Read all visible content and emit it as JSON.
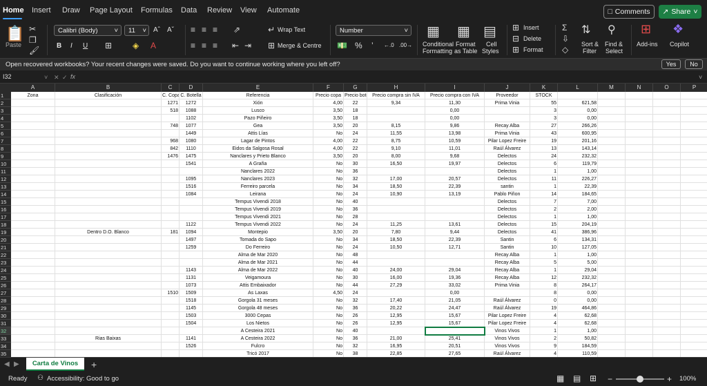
{
  "tabs": [
    "Home",
    "Insert",
    "Draw",
    "Page Layout",
    "Formulas",
    "Data",
    "Review",
    "View",
    "Automate"
  ],
  "header": {
    "comments": "Comments",
    "share": "Share"
  },
  "ribbon": {
    "paste": "Paste",
    "font_name": "Calibri (Body)",
    "font_size": "11",
    "wrap_text": "Wrap Text",
    "merge_center": "Merge & Centre",
    "number_format": "Number",
    "conditional": "Conditional",
    "formatting": "Formatting",
    "format_as": "Format",
    "as_table": "as Table",
    "cell": "Cell",
    "styles": "Styles",
    "insert": "Insert",
    "delete": "Delete",
    "format": "Format",
    "sort": "Sort &",
    "filter": "Filter",
    "find": "Find &",
    "select": "Select",
    "addins": "Add-ins",
    "copilot": "Copilot",
    "bold": "B",
    "italic": "I",
    "underline": "U"
  },
  "notice": {
    "text": "Open recovered workbooks?  Your recent changes were saved. Do you want to continue working where you left off?",
    "yes": "Yes",
    "no": "No"
  },
  "formula_bar": {
    "name_box": "I32",
    "fx": "fx"
  },
  "columns": [
    "A",
    "B",
    "C",
    "D",
    "E",
    "F",
    "G",
    "H",
    "I",
    "J",
    "K",
    "L",
    "M",
    "N",
    "O",
    "P",
    "Q"
  ],
  "headers": [
    "Zona",
    "Clasificación",
    "C. Copa",
    "C. Botella",
    "Referencia",
    "Precio copa",
    "Precio bote",
    "Precio compra sin IVA",
    "Precio compra con IVA",
    "Proveedor",
    "STOCK",
    "",
    "",
    "",
    "",
    "",
    ""
  ],
  "rows": [
    [
      "",
      "",
      "1271",
      "1272",
      "Xión",
      "4,00",
      "22",
      "9,34",
      "11,30",
      "Prima Vinia",
      "55",
      "621,58"
    ],
    [
      "",
      "",
      "518",
      "1088",
      "Lusco",
      "3,50",
      "18",
      "",
      "0,00",
      "",
      "3",
      "0,00"
    ],
    [
      "",
      "",
      "",
      "1102",
      "Pazo Piñeiro",
      "3,50",
      "18",
      "",
      "0,00",
      "",
      "3",
      "0,00"
    ],
    [
      "",
      "",
      "748",
      "1077",
      "Gea",
      "3,50",
      "20",
      "8,15",
      "9,86",
      "Recay Alba",
      "27",
      "266,26"
    ],
    [
      "",
      "",
      "",
      "1449",
      "Attis Lías",
      "No",
      "24",
      "11,55",
      "13,98",
      "Prima Vinia",
      "43",
      "600,95"
    ],
    [
      "",
      "",
      "968",
      "1080",
      "Lagar de Pintos",
      "4,00",
      "22",
      "8,75",
      "10,59",
      "Pilar Lopez Freire",
      "19",
      "201,16"
    ],
    [
      "",
      "",
      "842",
      "1110",
      "Eidos da Salgosa Rosal",
      "4,00",
      "22",
      "9,10",
      "11,01",
      "Raúl Álvarez",
      "13",
      "143,14"
    ],
    [
      "",
      "",
      "1476",
      "1475",
      "Nanclares y Prieto Blanco",
      "3,50",
      "20",
      "8,00",
      "9,68",
      "Delectos",
      "24",
      "232,32"
    ],
    [
      "",
      "",
      "",
      "1541",
      "A Graña",
      "No",
      "30",
      "16,50",
      "19,97",
      "Delectos",
      "6",
      "119,79"
    ],
    [
      "",
      "",
      "",
      "",
      "Nanclares 2022",
      "No",
      "36",
      "",
      "",
      "Delectos",
      "1",
      "1,00"
    ],
    [
      "",
      "",
      "",
      "1095",
      "Nanclares 2023",
      "No",
      "32",
      "17,00",
      "20,57",
      "Delectos",
      "11",
      "226,27"
    ],
    [
      "",
      "",
      "",
      "1516",
      "Ferreiro parcela",
      "No",
      "34",
      "18,50",
      "22,39",
      "santin",
      "1",
      "22,39"
    ],
    [
      "",
      "",
      "",
      "1084",
      "Leirana",
      "No",
      "24",
      "10,90",
      "13,19",
      "Pablo Piñon",
      "14",
      "184,65"
    ],
    [
      "",
      "",
      "",
      "",
      "Tempus Vivendi 2018",
      "No",
      "40",
      "",
      "",
      "Delectos",
      "7",
      "7,00"
    ],
    [
      "",
      "",
      "",
      "",
      "Tempus Vivendi 2019",
      "No",
      "36",
      "",
      "",
      "Delectos",
      "2",
      "2,00"
    ],
    [
      "",
      "",
      "",
      "",
      "Tempus Vivendi 2021",
      "No",
      "28",
      "",
      "",
      "Delectos",
      "1",
      "1,00"
    ],
    [
      "",
      "",
      "",
      "1122",
      "Tempus Vivendi 2022",
      "No",
      "24",
      "11,25",
      "13,61",
      "Delectos",
      "15",
      "204,19"
    ],
    [
      "",
      "Dentro D.O. Blanco",
      "181",
      "1094",
      "Montepio",
      "3,50",
      "20",
      "7,80",
      "9,44",
      "Delectos",
      "41",
      "386,96"
    ],
    [
      "",
      "",
      "",
      "1497",
      "Tomada do Sapo",
      "No",
      "34",
      "18,50",
      "22,39",
      "Santin",
      "6",
      "134,31"
    ],
    [
      "",
      "",
      "",
      "1259",
      "Do Ferreiro",
      "No",
      "24",
      "10,50",
      "12,71",
      "Santin",
      "10",
      "127,05"
    ],
    [
      "",
      "",
      "",
      "",
      "Alma de Mar 2020",
      "No",
      "48",
      "",
      "",
      "Recay Alba",
      "1",
      "1,00"
    ],
    [
      "",
      "",
      "",
      "",
      "Alma de Mar 2021",
      "No",
      "44",
      "",
      "",
      "Recay Alba",
      "5",
      "5,00"
    ],
    [
      "",
      "",
      "",
      "1143",
      "Alma de Mar 2022",
      "No",
      "40",
      "24,00",
      "29,04",
      "Recay Alba",
      "1",
      "29,04"
    ],
    [
      "",
      "",
      "",
      "1131",
      "Veigamoura",
      "No",
      "30",
      "16,00",
      "19,36",
      "Recay Alba",
      "12",
      "232,32"
    ],
    [
      "",
      "",
      "",
      "1073",
      "Attis Embaixador",
      "No",
      "44",
      "27,29",
      "33,02",
      "Prima Vinia",
      "8",
      "264,17"
    ],
    [
      "",
      "",
      "1510",
      "1509",
      "As Laxas",
      "4,50",
      "24",
      "",
      "0,00",
      "",
      "8",
      "0,00"
    ],
    [
      "",
      "",
      "",
      "1518",
      "Gorgola 31 meses",
      "No",
      "32",
      "17,40",
      "21,05",
      "Raúl Álvarez",
      "0",
      "0,00"
    ],
    [
      "",
      "",
      "",
      "1145",
      "Gorgola 48 meses",
      "No",
      "36",
      "20,22",
      "24,47",
      "Raúl Álvarez",
      "19",
      "464,86"
    ],
    [
      "",
      "",
      "",
      "1503",
      "3000 Cepas",
      "No",
      "26",
      "12,95",
      "15,67",
      "Pilar Lopez Freire",
      "4",
      "62,68"
    ],
    [
      "",
      "",
      "",
      "1504",
      "Los Nietos",
      "No",
      "26",
      "12,95",
      "15,67",
      "Pilar Lopez Freire",
      "4",
      "62,68"
    ],
    [
      "",
      "",
      "",
      "",
      "A Cesteira 2021",
      "No",
      "40",
      "",
      "",
      "Vinos Vivos",
      "1",
      "1,00"
    ],
    [
      "",
      "Rias Baixas",
      "",
      "1141",
      "A Cesteira 2022",
      "No",
      "36",
      "21,00",
      "25,41",
      "Vinos Vivos",
      "2",
      "50,82"
    ],
    [
      "",
      "",
      "",
      "1526",
      "Fulcro",
      "No",
      "32",
      "16,95",
      "20,51",
      "Vinos Vivos",
      "9",
      "184,59"
    ],
    [
      "",
      "",
      "",
      "",
      "Tricó 2017",
      "No",
      "38",
      "22,85",
      "27,65",
      "Raúl Álvarez",
      "4",
      "110,59"
    ]
  ],
  "sheet_tab": "Carta de Vinos",
  "status": {
    "ready": "Ready",
    "accessibility": "Accessibility: Good to go",
    "zoom": "100%"
  }
}
